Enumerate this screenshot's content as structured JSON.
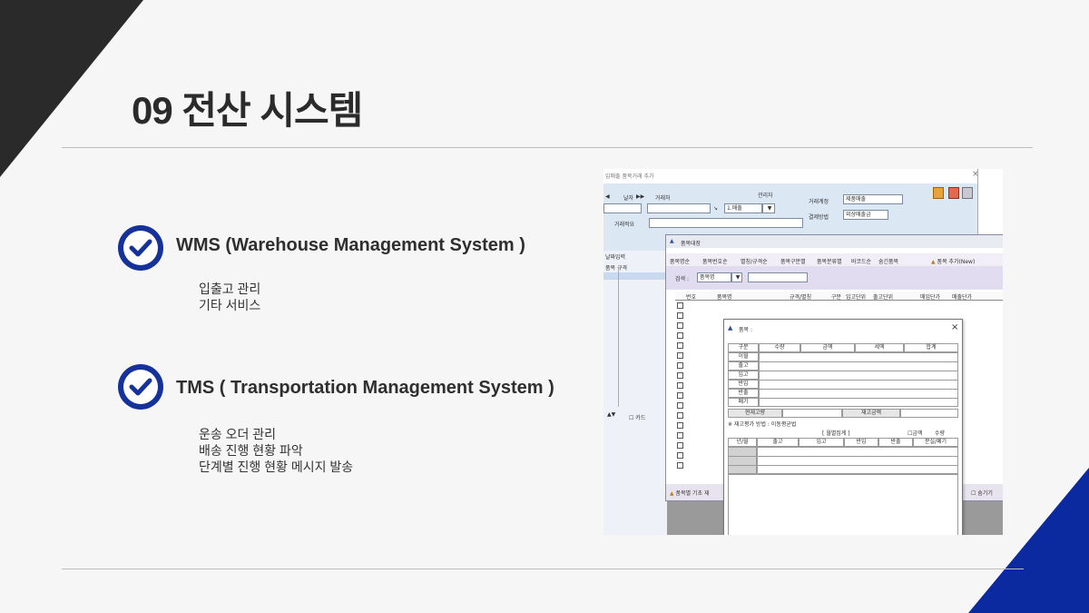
{
  "title": "09 전산 시스템",
  "sections": [
    {
      "heading": "WMS (Warehouse Management System )",
      "items": [
        "입출고 관리",
        "기타 서비스"
      ]
    },
    {
      "heading": "TMS ( Transportation Management System )",
      "items": [
        "운송 오더 관리",
        "배송 진행 현황 파악",
        "단계별 진행 현황 메시지 발송"
      ]
    }
  ],
  "colors": {
    "accent_blue": "#14329a",
    "corner_dark": "#2a2a2a",
    "corner_blue": "#0b2aa0"
  },
  "screenshot": {
    "w1": {
      "title": "입매출 품목거래 추가",
      "date_label": "날자",
      "account_label": "거래처",
      "manager_label": "관리자",
      "type_value": "1.매출",
      "summary_label": "거래적요",
      "account_mgmt_label": "거래계정",
      "account_mgmt_value": "제품매출",
      "payment_label": "결제방법",
      "payment_value": "외상매출금",
      "side_label": "날짜입력",
      "col_item": "품목 규격",
      "card_label": "카드"
    },
    "w2": {
      "title": "품목대장",
      "tabs": [
        "품목명순",
        "품목번호순",
        "별칭/규격순",
        "품목구분별",
        "품목분류별",
        "바코드순",
        "숨긴품목"
      ],
      "add_button": "품목 추가(New)",
      "search_label": "검색 :",
      "search_value": "품목명",
      "columns": [
        "번호",
        "품목명",
        "규격/별칭",
        "구분",
        "입고단위",
        "출고단위",
        "매입단가",
        "매출단가"
      ],
      "footer_label": "품목별 기초 재",
      "hide_label": "숨기기"
    },
    "w3": {
      "title": "품목 :",
      "summary_headers": [
        "구분",
        "수량",
        "금액",
        "세액",
        "합계"
      ],
      "summary_rows": [
        "이월",
        "출고",
        "입고",
        "반입",
        "반출",
        "폐기"
      ],
      "current_stock_label": "현재고량",
      "stock_amount_label": "재고금액",
      "valuation_note": "※ 재고평가 방법 : 이동평균법",
      "monthly_label": "[ 월별집계 ]",
      "amount_toggle": "금액",
      "qty_toggle": "수량",
      "monthly_headers": [
        "년/월",
        "출고",
        "입고",
        "반입",
        "반출",
        "분실/폐기"
      ]
    }
  }
}
